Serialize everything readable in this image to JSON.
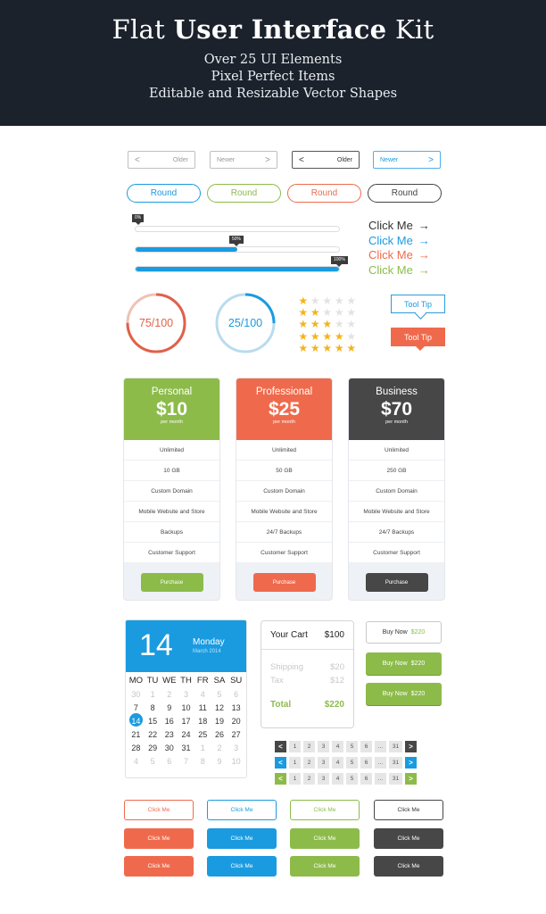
{
  "header": {
    "title_light": "Flat",
    "title_bold": "User Interface",
    "title_light2": "Kit",
    "subtitle_lines": [
      "Over 25 UI Elements",
      "Pixel Perfect Items",
      "Editable and Resizable Vector Shapes"
    ]
  },
  "colors": {
    "blue": "#1a9be0",
    "green": "#8cbb4a",
    "orange": "#ef6a4c",
    "dark": "#474747",
    "header_bg": "#1b222c"
  },
  "pagers": [
    {
      "label": "Older",
      "icon": "chevron-left-icon",
      "glyph": "<",
      "style": "light"
    },
    {
      "label": "Newer",
      "icon": "chevron-right-icon",
      "glyph": ">",
      "style": "light"
    },
    {
      "label": "Older",
      "icon": "chevron-left-icon",
      "glyph": "<",
      "style": "dark"
    },
    {
      "label": "Newer",
      "icon": "chevron-right-icon",
      "glyph": ">",
      "style": "blue"
    }
  ],
  "round_buttons": [
    {
      "label": "Round",
      "color": "#1a9be0"
    },
    {
      "label": "Round",
      "color": "#8cbb4a"
    },
    {
      "label": "Round",
      "color": "#ef6a4c"
    },
    {
      "label": "Round",
      "color": "#444444"
    }
  ],
  "progress_bars": [
    {
      "label": "0%",
      "value": 0
    },
    {
      "label": "50%",
      "value": 50
    },
    {
      "label": "100%",
      "value": 100
    }
  ],
  "click_links": [
    {
      "label": "Click Me",
      "arrow": "→",
      "color": "#333333"
    },
    {
      "label": "Click Me",
      "arrow": "→",
      "color": "#1a9be0"
    },
    {
      "label": "Click Me",
      "arrow": "→",
      "color": "#ef6a4c"
    },
    {
      "label": "Click Me",
      "arrow": "→",
      "color": "#8cbb4a"
    }
  ],
  "circles": [
    {
      "label": "75/100",
      "value": 75,
      "max": 100,
      "color": "#e0614a",
      "track": "#f0c2b6"
    },
    {
      "label": "25/100",
      "value": 25,
      "max": 100,
      "color": "#1a9be0",
      "track": "#b9dcee"
    }
  ],
  "star_ratings": [
    1,
    2,
    3,
    4,
    5
  ],
  "star_max": 5,
  "tooltips": [
    {
      "label": "Tool Tip",
      "style": "outline"
    },
    {
      "label": "Tool Tip",
      "style": "filled"
    }
  ],
  "plans": [
    {
      "name": "Personal",
      "price": "$10",
      "period": "per month",
      "color": "#8cbb4a",
      "features": [
        "Unlimited",
        "10 GB",
        "Custom Domain",
        "Mobile Website and Store",
        "Backups",
        "Customer Support"
      ],
      "button": "Purchase"
    },
    {
      "name": "Professional",
      "price": "$25",
      "period": "per month",
      "color": "#ef6a4c",
      "features": [
        "Unlimited",
        "50 GB",
        "Custom Domain",
        "Mobile Website and Store",
        "24/7 Backups",
        "Customer Support"
      ],
      "button": "Purchase"
    },
    {
      "name": "Business",
      "price": "$70",
      "period": "per month",
      "color": "#474747",
      "features": [
        "Unlimited",
        "250 GB",
        "Custom Domain",
        "Mobile Website and Store",
        "24/7 Backups",
        "Customer Support"
      ],
      "button": "Purchase"
    }
  ],
  "calendar": {
    "day": "14",
    "weekday": "Monday",
    "month_year": "March 2014",
    "headers": [
      "MO",
      "TU",
      "WE",
      "TH",
      "FR",
      "SA",
      "SU"
    ],
    "weeks": [
      [
        {
          "d": "30",
          "m": true
        },
        {
          "d": "1",
          "m": true
        },
        {
          "d": "2",
          "m": true
        },
        {
          "d": "3",
          "m": true
        },
        {
          "d": "4",
          "m": true
        },
        {
          "d": "5",
          "m": true
        },
        {
          "d": "6",
          "m": true
        }
      ],
      [
        {
          "d": "7"
        },
        {
          "d": "8"
        },
        {
          "d": "9"
        },
        {
          "d": "10"
        },
        {
          "d": "11"
        },
        {
          "d": "12"
        },
        {
          "d": "13"
        }
      ],
      [
        {
          "d": "14",
          "sel": true
        },
        {
          "d": "15"
        },
        {
          "d": "16"
        },
        {
          "d": "17"
        },
        {
          "d": "18"
        },
        {
          "d": "19"
        },
        {
          "d": "20"
        }
      ],
      [
        {
          "d": "21"
        },
        {
          "d": "22"
        },
        {
          "d": "23"
        },
        {
          "d": "24"
        },
        {
          "d": "25"
        },
        {
          "d": "26"
        },
        {
          "d": "27"
        }
      ],
      [
        {
          "d": "28"
        },
        {
          "d": "29"
        },
        {
          "d": "30"
        },
        {
          "d": "31"
        },
        {
          "d": "1",
          "m": true
        },
        {
          "d": "2",
          "m": true
        },
        {
          "d": "3",
          "m": true
        }
      ],
      [
        {
          "d": "4",
          "m": true
        },
        {
          "d": "5",
          "m": true
        },
        {
          "d": "6",
          "m": true
        },
        {
          "d": "7",
          "m": true
        },
        {
          "d": "8",
          "m": true
        },
        {
          "d": "9",
          "m": true
        },
        {
          "d": "10",
          "m": true
        }
      ]
    ]
  },
  "cart": {
    "title": "Your Cart",
    "subtotal": "$100",
    "lines": [
      {
        "label": "Shipping",
        "value": "$20"
      },
      {
        "label": "Tax",
        "value": "$12"
      }
    ],
    "total_label": "Total",
    "total_value": "$220"
  },
  "buy_buttons": [
    {
      "label": "Buy Now",
      "amount": "$220",
      "style": "outline"
    },
    {
      "label": "Buy Now",
      "amount": "$220",
      "style": "solid"
    },
    {
      "label": "Buy Now",
      "amount": "$220",
      "style": "solid"
    }
  ],
  "paginations": [
    {
      "color": "#474747",
      "pages": [
        "1",
        "2",
        "3",
        "4",
        "5",
        "6",
        "...",
        "31"
      ],
      "prev": "<",
      "next": ">"
    },
    {
      "color": "#1a9be0",
      "pages": [
        "1",
        "2",
        "3",
        "4",
        "5",
        "6",
        "...",
        "31"
      ],
      "prev": "<",
      "next": ">"
    },
    {
      "color": "#8cbb4a",
      "pages": [
        "1",
        "2",
        "3",
        "4",
        "5",
        "6",
        "...",
        "31"
      ],
      "prev": "<",
      "next": ">"
    }
  ],
  "click_buttons": {
    "label": "Click Me",
    "colors": [
      "#ef6a4c",
      "#1a9be0",
      "#8cbb4a",
      "#474747"
    ],
    "rows": [
      "outline",
      "solid",
      "solid"
    ]
  }
}
